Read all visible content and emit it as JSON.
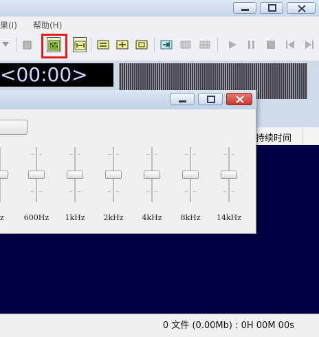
{
  "menubar": {
    "items": [
      "果(I)",
      "帮助(H)"
    ]
  },
  "display": {
    "time": "<00:00>"
  },
  "playlist": {
    "duration_header": "持续时间"
  },
  "status": {
    "text": "0 文件 (0.00Mb) : 0H 00M 00s"
  },
  "equalizer": {
    "bands": [
      "Hz",
      "600Hz",
      "1kHz",
      "2kHz",
      "4kHz",
      "8kHz",
      "14kHz"
    ]
  },
  "colors": {
    "highlight": "#e21c1c",
    "playlist_bg": "#000046",
    "time_text": "#cfd8ff",
    "close_button": "#d9443a"
  },
  "icons": {
    "toolbar": [
      "arrow-down-icon",
      "stop-square-icon",
      "equalizer-icon",
      "marker-icon",
      "loop-a-icon",
      "loop-b-icon",
      "loop-c-icon",
      "next-track-icon",
      "grid-icon",
      "grid-icon",
      "play-icon",
      "pause-icon",
      "stop-icon",
      "previous-icon",
      "next-icon"
    ]
  }
}
